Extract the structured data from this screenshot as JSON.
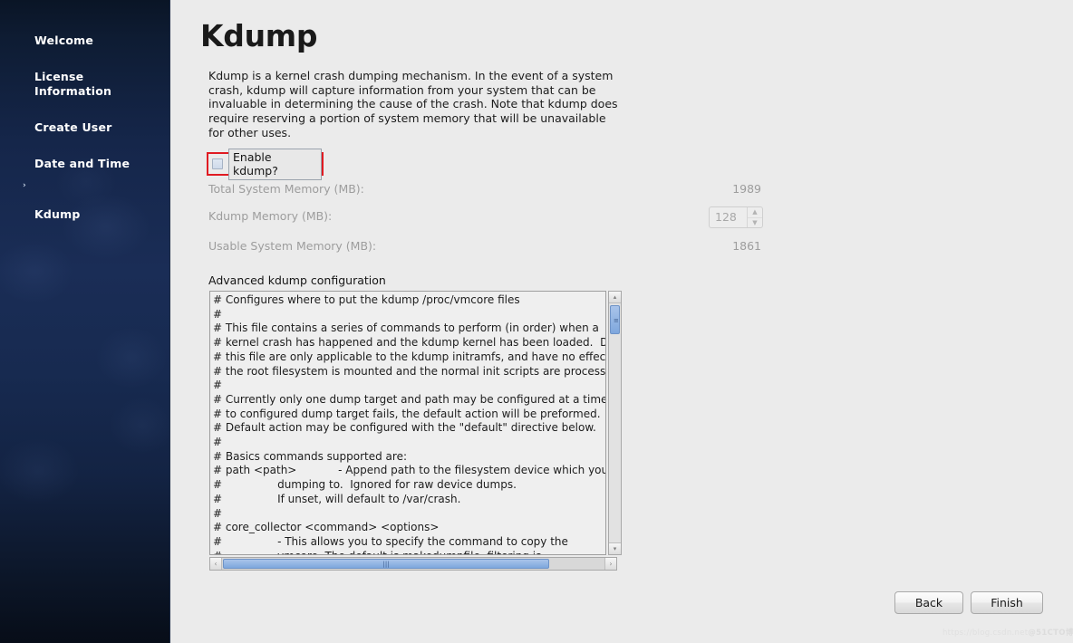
{
  "sidebar": {
    "items": [
      {
        "label": "Welcome",
        "active": false
      },
      {
        "label": "License\nInformation",
        "active": false
      },
      {
        "label": "Create User",
        "active": false
      },
      {
        "label": "Date and Time",
        "active": false
      },
      {
        "label": "Kdump",
        "active": true
      }
    ],
    "active_marker": "›"
  },
  "page": {
    "title": "Kdump",
    "description": "Kdump is a kernel crash dumping mechanism. In the event of a system crash, kdump will capture information from your system that can be invaluable in determining the cause of the crash. Note that kdump does require reserving a portion of system memory that will be unavailable for other uses."
  },
  "enable": {
    "label": "Enable kdump?",
    "checked": false,
    "highlight_color": "#e01b22"
  },
  "memory": {
    "rows": [
      {
        "label": "Total System Memory (MB):",
        "value": "1989",
        "type": "static"
      },
      {
        "label": "Kdump Memory (MB):",
        "value": "128",
        "type": "spinner"
      },
      {
        "label": "Usable System Memory (MB):",
        "value": "1861",
        "type": "static"
      }
    ],
    "disabled_color": "#9d9d9d"
  },
  "advanced": {
    "label": "Advanced kdump configuration",
    "content": "# Configures where to put the kdump /proc/vmcore files\n#\n# This file contains a series of commands to perform (in order) when a\n# kernel crash has happened and the kdump kernel has been loaded.  Directives in\n# this file are only applicable to the kdump initramfs, and have no effect once\n# the root filesystem is mounted and the normal init scripts are processed.\n#\n# Currently only one dump target and path may be configured at a time.  If the\n# to configured dump target fails, the default action will be preformed.  The\n# Default action may be configured with the \"default\" directive below.\n#\n# Basics commands supported are:\n# path <path>            - Append path to the filesystem device which you are\n#                dumping to.  Ignored for raw device dumps.\n#                If unset, will default to /var/crash.\n#\n# core_collector <command> <options>\n#                - This allows you to specify the command to copy the\n#                vmcore. The default is makedumpfile, filtering is",
    "scroll": {
      "vertical_arrow_up": "▴",
      "vertical_arrow_down": "▾",
      "horizontal_arrow_left": "‹",
      "horizontal_arrow_right": "›",
      "grip": "|||"
    }
  },
  "footer": {
    "back_label": "Back",
    "finish_label": "Finish"
  },
  "watermark": {
    "text_faint": "https://blog.csdn.net",
    "text_strong": "@51CTO博客"
  }
}
